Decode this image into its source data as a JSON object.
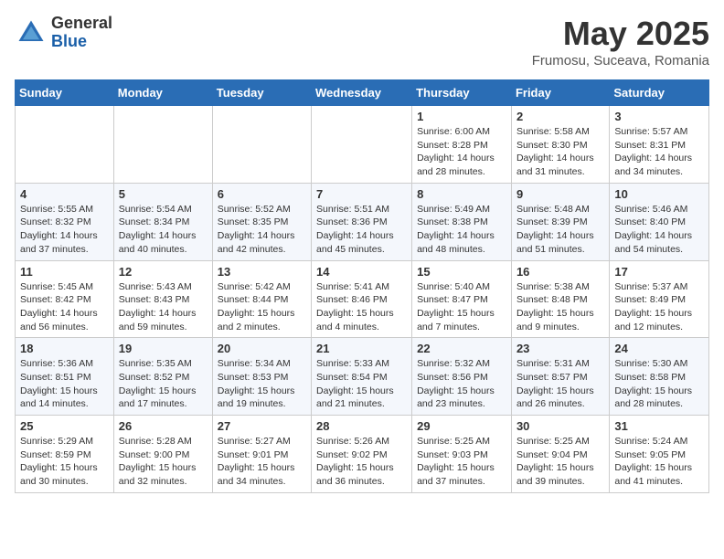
{
  "header": {
    "logo_general": "General",
    "logo_blue": "Blue",
    "title": "May 2025",
    "location": "Frumosu, Suceava, Romania"
  },
  "weekdays": [
    "Sunday",
    "Monday",
    "Tuesday",
    "Wednesday",
    "Thursday",
    "Friday",
    "Saturday"
  ],
  "weeks": [
    [
      {
        "day": "",
        "info": ""
      },
      {
        "day": "",
        "info": ""
      },
      {
        "day": "",
        "info": ""
      },
      {
        "day": "",
        "info": ""
      },
      {
        "day": "1",
        "info": "Sunrise: 6:00 AM\nSunset: 8:28 PM\nDaylight: 14 hours\nand 28 minutes."
      },
      {
        "day": "2",
        "info": "Sunrise: 5:58 AM\nSunset: 8:30 PM\nDaylight: 14 hours\nand 31 minutes."
      },
      {
        "day": "3",
        "info": "Sunrise: 5:57 AM\nSunset: 8:31 PM\nDaylight: 14 hours\nand 34 minutes."
      }
    ],
    [
      {
        "day": "4",
        "info": "Sunrise: 5:55 AM\nSunset: 8:32 PM\nDaylight: 14 hours\nand 37 minutes."
      },
      {
        "day": "5",
        "info": "Sunrise: 5:54 AM\nSunset: 8:34 PM\nDaylight: 14 hours\nand 40 minutes."
      },
      {
        "day": "6",
        "info": "Sunrise: 5:52 AM\nSunset: 8:35 PM\nDaylight: 14 hours\nand 42 minutes."
      },
      {
        "day": "7",
        "info": "Sunrise: 5:51 AM\nSunset: 8:36 PM\nDaylight: 14 hours\nand 45 minutes."
      },
      {
        "day": "8",
        "info": "Sunrise: 5:49 AM\nSunset: 8:38 PM\nDaylight: 14 hours\nand 48 minutes."
      },
      {
        "day": "9",
        "info": "Sunrise: 5:48 AM\nSunset: 8:39 PM\nDaylight: 14 hours\nand 51 minutes."
      },
      {
        "day": "10",
        "info": "Sunrise: 5:46 AM\nSunset: 8:40 PM\nDaylight: 14 hours\nand 54 minutes."
      }
    ],
    [
      {
        "day": "11",
        "info": "Sunrise: 5:45 AM\nSunset: 8:42 PM\nDaylight: 14 hours\nand 56 minutes."
      },
      {
        "day": "12",
        "info": "Sunrise: 5:43 AM\nSunset: 8:43 PM\nDaylight: 14 hours\nand 59 minutes."
      },
      {
        "day": "13",
        "info": "Sunrise: 5:42 AM\nSunset: 8:44 PM\nDaylight: 15 hours\nand 2 minutes."
      },
      {
        "day": "14",
        "info": "Sunrise: 5:41 AM\nSunset: 8:46 PM\nDaylight: 15 hours\nand 4 minutes."
      },
      {
        "day": "15",
        "info": "Sunrise: 5:40 AM\nSunset: 8:47 PM\nDaylight: 15 hours\nand 7 minutes."
      },
      {
        "day": "16",
        "info": "Sunrise: 5:38 AM\nSunset: 8:48 PM\nDaylight: 15 hours\nand 9 minutes."
      },
      {
        "day": "17",
        "info": "Sunrise: 5:37 AM\nSunset: 8:49 PM\nDaylight: 15 hours\nand 12 minutes."
      }
    ],
    [
      {
        "day": "18",
        "info": "Sunrise: 5:36 AM\nSunset: 8:51 PM\nDaylight: 15 hours\nand 14 minutes."
      },
      {
        "day": "19",
        "info": "Sunrise: 5:35 AM\nSunset: 8:52 PM\nDaylight: 15 hours\nand 17 minutes."
      },
      {
        "day": "20",
        "info": "Sunrise: 5:34 AM\nSunset: 8:53 PM\nDaylight: 15 hours\nand 19 minutes."
      },
      {
        "day": "21",
        "info": "Sunrise: 5:33 AM\nSunset: 8:54 PM\nDaylight: 15 hours\nand 21 minutes."
      },
      {
        "day": "22",
        "info": "Sunrise: 5:32 AM\nSunset: 8:56 PM\nDaylight: 15 hours\nand 23 minutes."
      },
      {
        "day": "23",
        "info": "Sunrise: 5:31 AM\nSunset: 8:57 PM\nDaylight: 15 hours\nand 26 minutes."
      },
      {
        "day": "24",
        "info": "Sunrise: 5:30 AM\nSunset: 8:58 PM\nDaylight: 15 hours\nand 28 minutes."
      }
    ],
    [
      {
        "day": "25",
        "info": "Sunrise: 5:29 AM\nSunset: 8:59 PM\nDaylight: 15 hours\nand 30 minutes."
      },
      {
        "day": "26",
        "info": "Sunrise: 5:28 AM\nSunset: 9:00 PM\nDaylight: 15 hours\nand 32 minutes."
      },
      {
        "day": "27",
        "info": "Sunrise: 5:27 AM\nSunset: 9:01 PM\nDaylight: 15 hours\nand 34 minutes."
      },
      {
        "day": "28",
        "info": "Sunrise: 5:26 AM\nSunset: 9:02 PM\nDaylight: 15 hours\nand 36 minutes."
      },
      {
        "day": "29",
        "info": "Sunrise: 5:25 AM\nSunset: 9:03 PM\nDaylight: 15 hours\nand 37 minutes."
      },
      {
        "day": "30",
        "info": "Sunrise: 5:25 AM\nSunset: 9:04 PM\nDaylight: 15 hours\nand 39 minutes."
      },
      {
        "day": "31",
        "info": "Sunrise: 5:24 AM\nSunset: 9:05 PM\nDaylight: 15 hours\nand 41 minutes."
      }
    ]
  ]
}
